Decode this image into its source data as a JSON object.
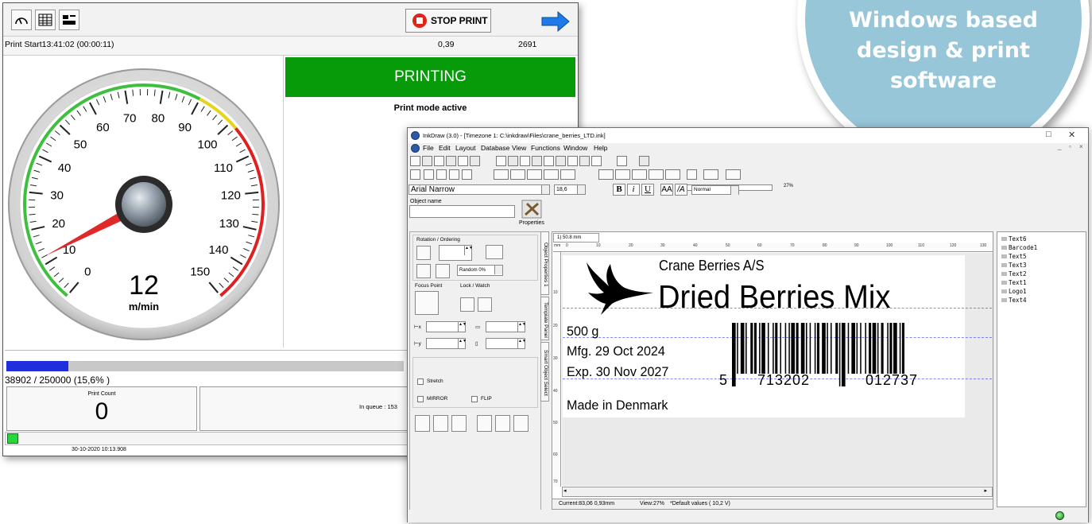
{
  "controller": {
    "stop_label": "STOP PRINT",
    "status_left": "Print Start13:41:02 (00:00:11)",
    "status_mid": "0,39",
    "status_right": "2691",
    "speed_value": "12",
    "speed_unit": "m/min",
    "gauge_min": 0,
    "gauge_max": 150,
    "gauge_needle_value": 12,
    "gauge_ticks": [
      "0",
      "10",
      "20",
      "30",
      "40",
      "50",
      "60",
      "70",
      "80",
      "90",
      "100",
      "110",
      "120",
      "130",
      "140",
      "150"
    ],
    "banner": "PRINTING",
    "mode": "Print mode active",
    "progress_text": "38902 / 250000  (15,6% )",
    "progress_fraction": 0.156,
    "count_title": "Print Count",
    "count_value": "0",
    "queue_text": "In queue : 153",
    "footer_date": "30-10-2020 10:13.908",
    "colors": {
      "banner": "#079b0a",
      "progress": "#1f2fdc",
      "stop": "#e2231a"
    }
  },
  "badge": {
    "line1": "Windows based",
    "line2": "design & print",
    "line3": "software",
    "color": "#97c6d8"
  },
  "inkdraw": {
    "title": "InkDraw  (3.0) - [Timezone 1: C:\\inkdraw\\Files\\crane_berries_LTD.ink]",
    "menu": [
      "File",
      "Edit",
      "Layout",
      "Database",
      "View",
      "Functions",
      "Window",
      "Help"
    ],
    "zoom": "27%",
    "font": "Arial Narrow",
    "font_size": "18,6",
    "bold": "B",
    "italic": "i",
    "underline": "U",
    "style": "Normal",
    "object_name_label": "Object name",
    "properties_label": "Properties",
    "rotation_label": "Rotation / Ordering",
    "random_label": "Random 0%",
    "focus_label": "Focus Point",
    "lock_label": "Lock / Watch",
    "stretch_label": "Stretch",
    "mirror_label": "MIRROR",
    "flip_label": "FLIP",
    "vtab1": "Object Properties 1",
    "vtab2": "Template Panel",
    "vtab3": "Smart Object Select",
    "canvas_tab": "1) 50.8 mm",
    "ruler_top": [
      "mm",
      "0",
      "10",
      "20",
      "30",
      "40",
      "50",
      "60",
      "70",
      "80",
      "90",
      "100",
      "110",
      "120",
      "130"
    ],
    "ruler_left": [
      "10",
      "20",
      "30",
      "40",
      "50",
      "60",
      "70"
    ],
    "label": {
      "company": "Crane Berries A/S",
      "product": "Dried Berries Mix",
      "weight": "500 g",
      "mfg": "Mfg. 29 Oct 2024",
      "exp": "Exp. 30 Nov 2027",
      "origin": "Made in Denmark",
      "barcode_digit": "5",
      "barcode_left": "713202",
      "barcode_right": "012737"
    },
    "status_current": "Current:83,06 0,93mm",
    "status_view": "View:27%",
    "status_values": "*Default values ( 10,2 V)",
    "tree": [
      "Text6",
      "Barcode1",
      "Text5",
      "Text3",
      "Text2",
      "Text1",
      "Logo1",
      "Text4"
    ]
  }
}
